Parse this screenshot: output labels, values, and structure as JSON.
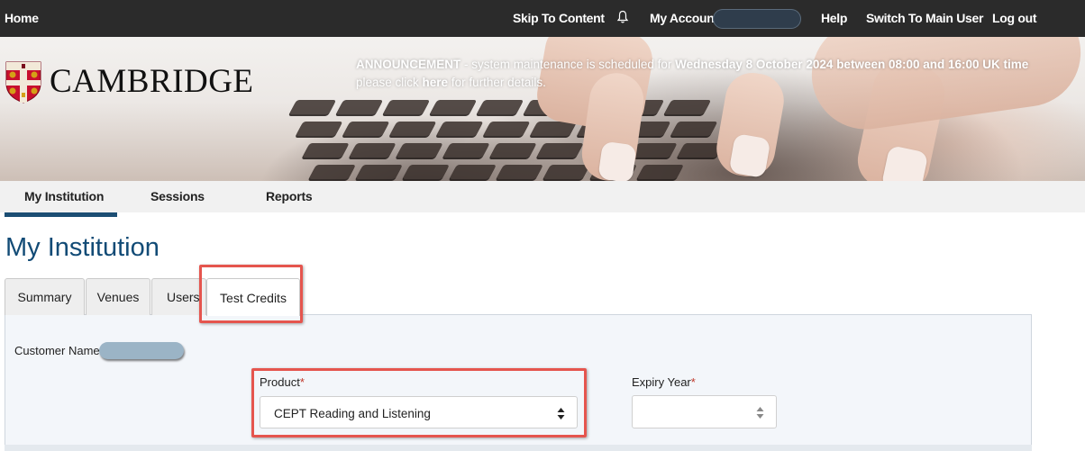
{
  "topbar": {
    "home": "Home",
    "skip": "Skip To Content",
    "account": "My Account",
    "help": "Help",
    "switch": "Switch To Main User",
    "logout": "Log out"
  },
  "banner": {
    "logo_text": "CAMBRIDGE",
    "announce_label": "ANNOUNCEMENT",
    "announce_text1": " - system maintenance is scheduled for ",
    "announce_date": "Wednesday 8 October 2024 between 08:00 and 16:00 UK time",
    "announce_text2": " please click ",
    "announce_link": "here",
    "announce_text3": " for further details."
  },
  "nav": {
    "items": [
      "My Institution",
      "Sessions",
      "Reports"
    ],
    "active": "My Institution"
  },
  "page": {
    "title": "My Institution"
  },
  "tabs": {
    "items": [
      "Summary",
      "Venues",
      "Users",
      "Test Credits"
    ],
    "active": "Test Credits"
  },
  "form": {
    "customer_label": "Customer Name",
    "product_label": "Product",
    "product_value": "CEPT Reading and Listening",
    "expiry_label": "Expiry Year",
    "expiry_value": "",
    "required_mark": "*"
  },
  "colors": {
    "topbar_bg": "#2b2b2b",
    "title": "#124b76",
    "nav_underline": "#1c4e74",
    "highlight": "#e5554e",
    "required": "#c0392b"
  },
  "icons": [
    "bell-icon",
    "select-arrows-icon",
    "cambridge-shield-icon"
  ]
}
